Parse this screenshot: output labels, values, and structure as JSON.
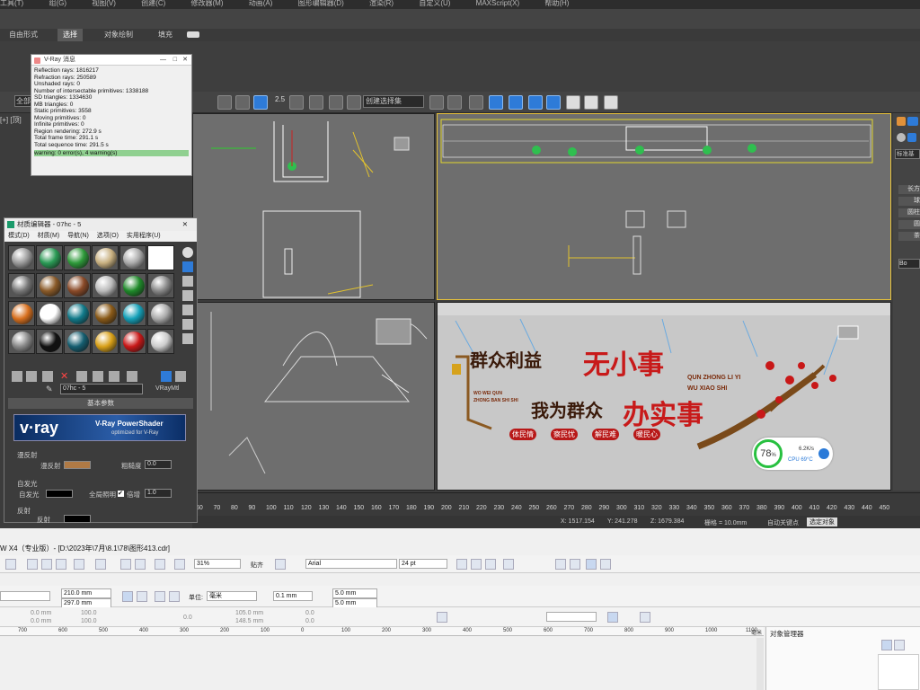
{
  "menubar": {
    "items": [
      "工具(T)",
      "组(G)",
      "视图(V)",
      "创建(C)",
      "修改器(M)",
      "动画(A)",
      "图形编辑器(D)",
      "渲染(R)",
      "自定义(U)",
      "MAXScript(X)",
      "帮助(H)"
    ]
  },
  "ribbon_tabs": [
    "自由形式",
    "选择",
    "对象绘制",
    "填充"
  ],
  "toolbar": {
    "selection_filter": "全部",
    "selection_set": "创建选择集",
    "snap_value": "2.5"
  },
  "viewport_label": "[+] [顶]",
  "vray_messages": {
    "title": "V-Ray 消息",
    "lines": [
      "Reflection rays: 1816217",
      "Refraction rays: 250589",
      "Unshaded rays: 0",
      "Number of intersectable primitives: 1338188",
      "SD triangles: 1334630",
      "MB triangles: 0",
      "Static primitives: 3558",
      "Moving primitives: 0",
      "Infinite primitives: 0",
      "Region rendering: 272.9 s",
      "Total frame time: 291.1 s",
      "Total sequence time: 291.5 s"
    ],
    "warning": "warning: 0 error(s), 4 warning(s)"
  },
  "material_editor": {
    "title": "材质编辑器 - 07hc - 5",
    "menu": [
      "模式(D)",
      "材质(M)",
      "导航(N)",
      "选项(O)",
      "实用程序(U)"
    ],
    "material_name": "07hc - 5",
    "material_type": "VRayMtl",
    "rollout_basic": "基本参数",
    "banner_logo": "v·ray",
    "banner_title": "V-Ray PowerShader",
    "banner_sub": "optimized for V-Ray",
    "diffuse_group": "漫反射",
    "diffuse_label": "漫反射",
    "roughness_label": "粗糙度",
    "roughness_value": "0.0",
    "selfillum_group": "自发光",
    "selfillum_label": "自发光",
    "gi_label": "全局照明",
    "multiplier_label": "倍增",
    "multiplier_value": "1.0",
    "reflect_group": "反射",
    "reflect_label": "反射",
    "diffuse_color": "#b07a45",
    "sphere_colors": [
      "#9a9a9a",
      "#2a9a55",
      "#2e9a3a",
      "#c8b080",
      "#aaaaaa",
      "#ffffff",
      "#777777",
      "#8a5a28",
      "#8a4a28",
      "#bbbbbb",
      "#1f8a2a",
      "#888888",
      "#d8701e",
      "#ffffff",
      "#117a8a",
      "#8a5a18",
      "#14a0b8",
      "#aaaaaa",
      "#888888",
      "#111111",
      "#155e70",
      "#d8a018",
      "#c81818",
      "#cccccc"
    ]
  },
  "perspective_sign": {
    "line1_a": "群众利益",
    "line1_b": "无小事",
    "line2_a": "我为群众",
    "line2_b": "办实事",
    "pinyin1": "QUN ZHONG LI YI",
    "pinyin2": "WU XIAO SHI",
    "pinyin_left1": "WO WEI QUN",
    "pinyin_left2": "ZHONG BAN SHI SHI",
    "tags": [
      "体民情",
      "察民忧",
      "解民难",
      "暖民心"
    ]
  },
  "cpu_widget": {
    "percent": "78",
    "percent_sign": "%",
    "speed": "6.2K/s",
    "cpu": "CPU 69°C"
  },
  "timeline_ticks": [
    "60",
    "70",
    "80",
    "90",
    "100",
    "110",
    "120",
    "130",
    "140",
    "150",
    "160",
    "170",
    "180",
    "190",
    "200",
    "210",
    "220",
    "230",
    "240",
    "250",
    "260",
    "270",
    "280",
    "290",
    "300",
    "310",
    "320",
    "330",
    "340",
    "350",
    "360",
    "370",
    "380",
    "390",
    "400",
    "410",
    "420",
    "430",
    "440",
    "450"
  ],
  "status": {
    "x": "X: 1517.154",
    "y": "Y: 241.278",
    "z": "Z: 1679.384",
    "grid": "栅格 = 10.0mm",
    "auto_key": "自动关键点",
    "select": "选定对象"
  },
  "command_panel": {
    "dropdown": "标准基",
    "items": [
      "长方",
      "球",
      "圆柱",
      "圆",
      "茶"
    ],
    "name": "Bo"
  },
  "corel": {
    "title": "W X4（专业版）- [D:\\2023年\\7月\\8.1\\78\\图形413.cdr]",
    "zoom": "31%",
    "snap": "贴齐",
    "font": "Arial",
    "font_size": "24 pt",
    "width": "210.0 mm",
    "height": "297.0 mm",
    "unit_label": "单位:",
    "unit": "毫米",
    "nudge": "0.1 mm",
    "dup_x": "5.0 mm",
    "dup_y": "5.0 mm",
    "pos_x": "0.0 mm",
    "pos_y": "0.0 mm",
    "scale1": "100.0",
    "scale2": "100.0",
    "angle": "0.0",
    "size_w": "105.0 mm",
    "size_h": "148.5 mm",
    "val1": "0.0",
    "val2": "0.0",
    "ruler_ticks": [
      "700",
      "600",
      "500",
      "400",
      "300",
      "200",
      "100",
      "0",
      "100",
      "200",
      "300",
      "400",
      "500",
      "600",
      "700",
      "800",
      "900",
      "1000",
      "1100"
    ],
    "ruler_unit": "毫米",
    "obj_manager": "对象管理器"
  }
}
